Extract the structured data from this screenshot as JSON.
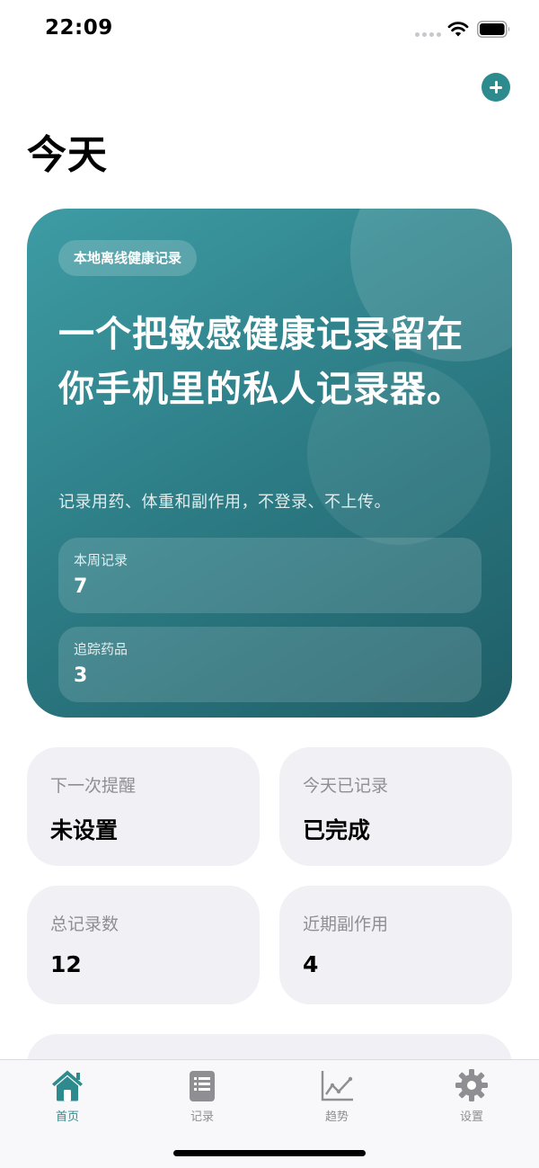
{
  "status_bar": {
    "time": "22:09"
  },
  "header": {
    "title": "今天"
  },
  "hero": {
    "badge": "本地离线健康记录",
    "title": "一个把敏感健康记录留在你手机里的私人记录器。",
    "subtitle": "记录用药、体重和副作用，不登录、不上传。",
    "stats": [
      {
        "label": "本周记录",
        "value": "7"
      },
      {
        "label": "追踪药品",
        "value": "3"
      }
    ]
  },
  "cards": [
    {
      "label": "下一次提醒",
      "value": "未设置"
    },
    {
      "label": "今天已记录",
      "value": "已完成"
    },
    {
      "label": "总记录数",
      "value": "12"
    },
    {
      "label": "近期副作用",
      "value": "4"
    }
  ],
  "tabs": [
    {
      "label": "首页",
      "icon": "house-icon",
      "active": true
    },
    {
      "label": "记录",
      "icon": "list-icon",
      "active": false
    },
    {
      "label": "趋势",
      "icon": "chart-icon",
      "active": false
    },
    {
      "label": "设置",
      "icon": "gear-icon",
      "active": false
    }
  ],
  "colors": {
    "accent": "#2e8b8d",
    "card_bg": "#f1f1f5",
    "secondary_text": "#8e8e93"
  }
}
